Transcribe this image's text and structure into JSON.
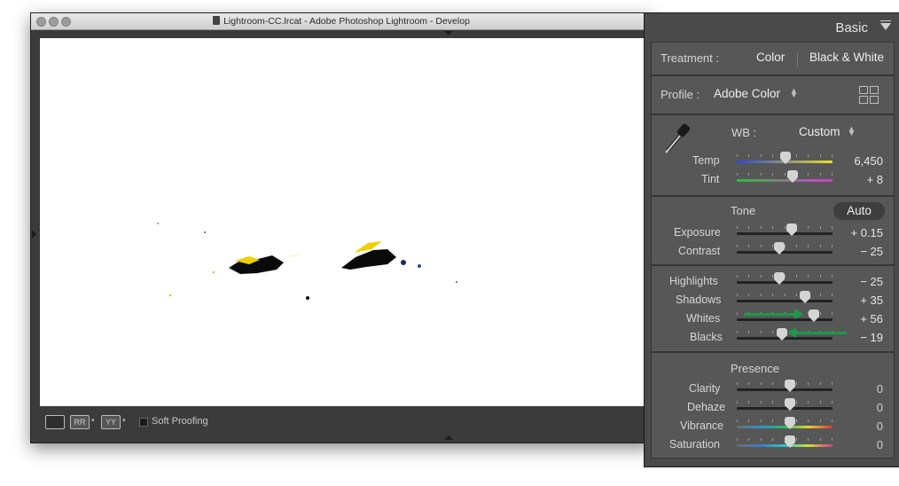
{
  "window": {
    "title": "Lightroom-CC.lrcat - Adobe Photoshop Lightroom - Develop"
  },
  "toolbar": {
    "view_loupe": "",
    "view_before_after": "RR",
    "view_yy": "YY",
    "soft_proofing_label": "Soft Proofing",
    "soft_proofing_checked": false
  },
  "panel": {
    "title": "Basic",
    "treatment_label": "Treatment :",
    "treatment_color": "Color",
    "treatment_bw": "Black & White",
    "profile_label": "Profile :",
    "profile_value": "Adobe Color",
    "wb_label": "WB :",
    "wb_value": "Custom",
    "tone_label": "Tone",
    "auto_label": "Auto",
    "presence_label": "Presence",
    "sliders": {
      "temp": {
        "label": "Temp",
        "value": "6,450",
        "fraction": 0.45
      },
      "tint": {
        "label": "Tint",
        "value": "+ 8",
        "fraction": 0.53
      },
      "exposure": {
        "label": "Exposure",
        "value": "+ 0.15",
        "fraction": 0.52
      },
      "contrast": {
        "label": "Contrast",
        "value": "− 25",
        "fraction": 0.39
      },
      "highlights": {
        "label": "Highlights",
        "value": "− 25",
        "fraction": 0.39
      },
      "shadows": {
        "label": "Shadows",
        "value": "+ 35",
        "fraction": 0.66
      },
      "whites": {
        "label": "Whites",
        "value": "+ 56",
        "fraction": 0.75
      },
      "blacks": {
        "label": "Blacks",
        "value": "− 19",
        "fraction": 0.42
      },
      "clarity": {
        "label": "Clarity",
        "value": "0",
        "fraction": 0.5
      },
      "dehaze": {
        "label": "Dehaze",
        "value": "0",
        "fraction": 0.5
      },
      "vibrance": {
        "label": "Vibrance",
        "value": "0",
        "fraction": 0.5
      },
      "saturation": {
        "label": "Saturation",
        "value": "0",
        "fraction": 0.5
      }
    }
  },
  "colors": {
    "arrow_green": "#1c9a4a",
    "panel_bg": "#4a4a4a",
    "section_bg": "#575757"
  }
}
